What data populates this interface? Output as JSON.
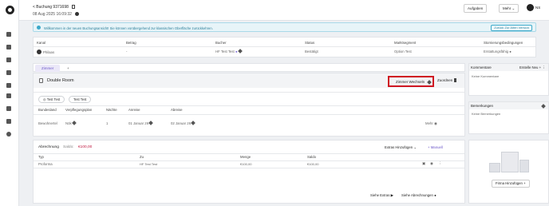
{
  "header": {
    "back_label": "< Buchung 9371698",
    "date": "08 Aug 2025 16:09:32",
    "aufgaben": "Aufgaben",
    "mehr": "Mehr",
    "user_initials": "NS"
  },
  "banner": {
    "text": "Willkommen in der neuen Buchungsansicht! Sie können vorübergehend zur klassischen Oberfläche zurückkehren.",
    "button": "Zurück Zur Alten Version"
  },
  "booking_table": {
    "headers": [
      "Kanal",
      "Betrag",
      "Bucher",
      "Status",
      "Marktsegment",
      "Stornierungsbedingungen"
    ],
    "row": [
      "Philaas",
      "-",
      "HF Test Test",
      "Bestätigt",
      "Option Test",
      "Erstattungsfähig"
    ]
  },
  "tabs": {
    "zimmer": "Zimmer",
    "add": "+"
  },
  "room": {
    "name": "Double Room",
    "swap_label": "Zimmer Wechseln",
    "assign_label": "Zuordnen",
    "guests": [
      "Test Test",
      "Test Test"
    ],
    "columns": [
      "Bundesland",
      "Verpflegungsplan",
      "Nächte",
      "Anreise",
      "Abreise"
    ],
    "row": [
      "Bewohnertel",
      "Nök",
      "1",
      "01 Januar 26",
      "02 Januar 26"
    ],
    "mehr": "Mehr"
  },
  "accounting": {
    "title": "Abrechnung",
    "saldo_label": "Saldo:",
    "saldo_value": "€100,00",
    "extras_add": "Extras Hinzufügen",
    "manuell": "Manuell",
    "columns": [
      "Typ",
      "Zu",
      "Menge",
      "Saldo"
    ],
    "row": [
      "Proforma",
      "HF Test Test",
      "€100,00",
      "€100,00"
    ],
    "see_extras": "Siehe Extras",
    "see_invoices": "Siehe Abrechnungen"
  },
  "comments": {
    "title": "Kommentare",
    "create_new": "Erstelle Neu",
    "empty": "Keine Kommentare"
  },
  "remarks": {
    "title": "Bemerkungen",
    "empty": "Keine Bemerkungen"
  },
  "company": {
    "add_label": "Firma Hinzufügen"
  },
  "colors": {
    "accent": "#6a55c8",
    "highlight": "#cf1722",
    "saldo": "#c0183f"
  }
}
